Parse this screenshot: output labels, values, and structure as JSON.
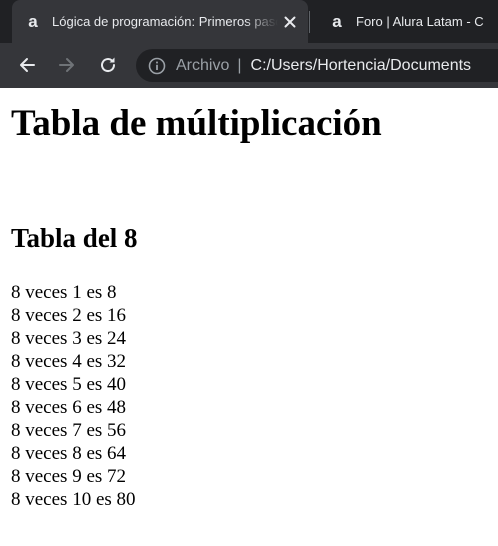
{
  "tabs": [
    {
      "title": "Lógica de programación: Primeros pasos",
      "favicon": "alura-a-icon",
      "active": true
    },
    {
      "title": "Foro | Alura Latam - C",
      "favicon": "alura-a-icon",
      "active": false
    }
  ],
  "toolbar": {
    "chip_label": "Archivo",
    "separator": "|",
    "url": "C:/Users/Hortencia/Documents"
  },
  "page": {
    "heading": "Tabla de múltiplicación",
    "subheading": "Tabla del 8",
    "rows": [
      "8 veces 1 es 8",
      "8 veces 2 es 16",
      "8 veces 3 es 24",
      "8 veces 4 es 32",
      "8 veces 5 es 40",
      "8 veces 6 es 48",
      "8 veces 7 es 56",
      "8 veces 8 es 64",
      "8 veces 9 es 72",
      "8 veces 10 es 80"
    ]
  },
  "colors": {
    "tabstrip": "#202124",
    "toolbar": "#35363a",
    "omnibox": "#202124",
    "page_background": "#ffffff"
  }
}
